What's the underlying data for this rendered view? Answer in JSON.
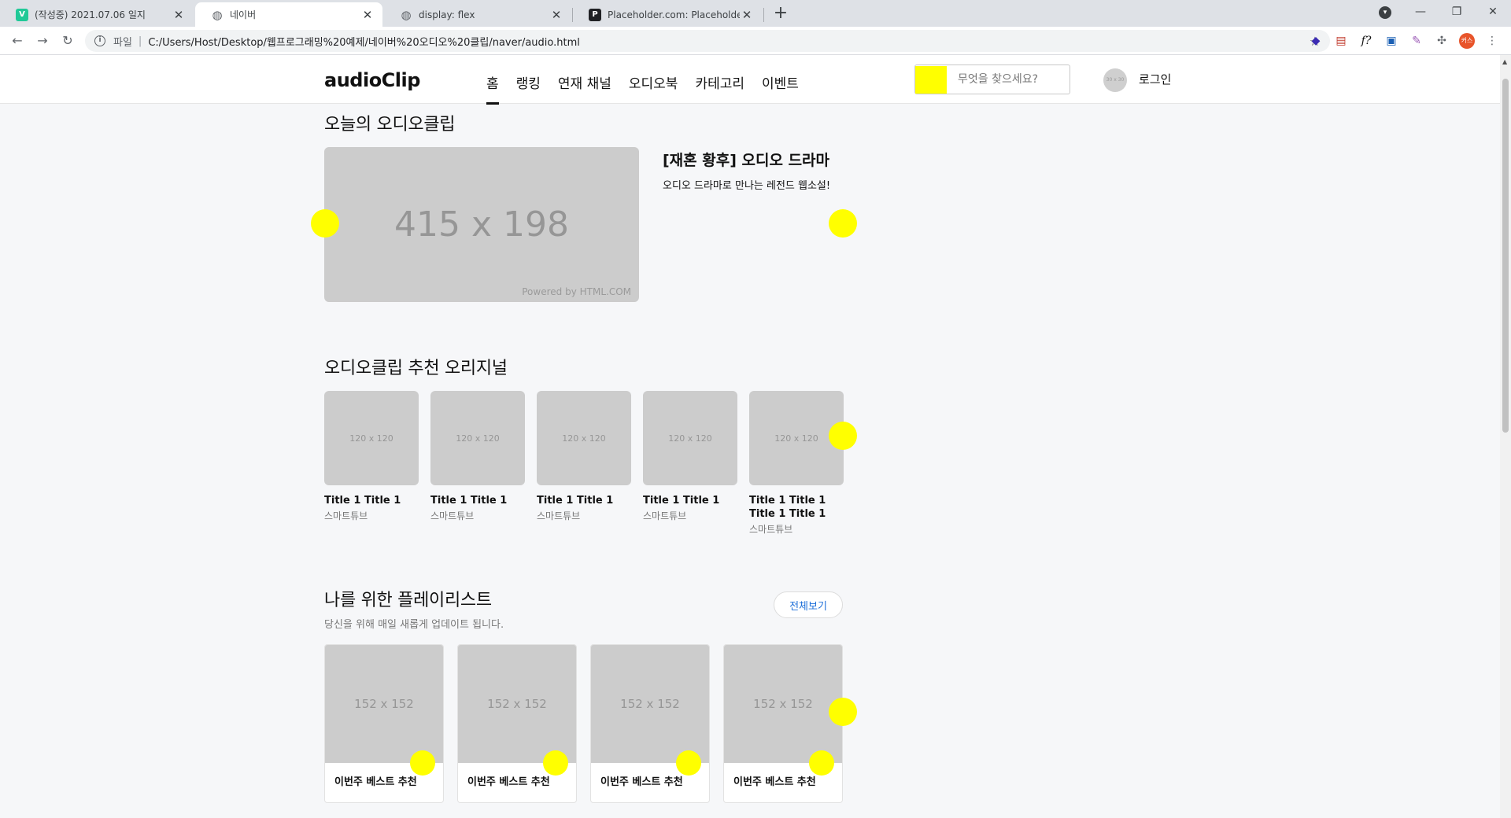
{
  "browser": {
    "tabs": [
      {
        "title": "(작성중) 2021.07.06 일지",
        "favicon": "v-icon"
      },
      {
        "title": "네이버",
        "favicon": "globe-icon",
        "active": true
      },
      {
        "title": "display: flex",
        "favicon": "globe-icon"
      },
      {
        "title": "Placeholder.com: Placeholder.co",
        "favicon": "p-icon"
      }
    ],
    "address": {
      "scheme": "파일",
      "url": "C:/Users/Host/Desktop/웹프로그래밍%20예제/네이버%20오디오%20클립/naver/audio.html"
    },
    "profile_badge": "커스"
  },
  "header": {
    "logo": "audioClip",
    "nav": [
      "홈",
      "랭킹",
      "연재 채널",
      "오디오북",
      "카테고리",
      "이벤트"
    ],
    "search_placeholder": "무엇을 찾으세요?",
    "avatar_label": "30 x 30",
    "login": "로그인"
  },
  "today": {
    "title": "오늘의 오디오클립",
    "image_label": "415 x 198",
    "image_powered": "Powered by HTML.COM",
    "item_title": "[재혼 황후] 오디오 드라마",
    "item_desc": "오디오 드라마로 만나는 레전드 웹소설!"
  },
  "originals": {
    "title": "오디오클립 추천 오리지널",
    "image_label": "120 x 120",
    "items": [
      {
        "title": "Title 1 Title 1",
        "sub": "스마트튜브"
      },
      {
        "title": "Title 1 Title 1",
        "sub": "스마트튜브"
      },
      {
        "title": "Title 1 Title 1",
        "sub": "스마트튜브"
      },
      {
        "title": "Title 1 Title 1",
        "sub": "스마트튜브"
      },
      {
        "title": "Title 1 Title 1 Title 1 Title 1",
        "sub": "스마트튜브"
      }
    ]
  },
  "playlist": {
    "title": "나를 위한 플레이리스트",
    "subtitle": "당신을 위해 매일 새롭게 업데이트 됩니다.",
    "view_all": "전체보기",
    "image_label": "152 x 152",
    "items": [
      {
        "title": "이번주 베스트 추천"
      },
      {
        "title": "이번주 베스트 추천"
      },
      {
        "title": "이번주 베스트 추천"
      },
      {
        "title": "이번주 베스트 추천"
      }
    ]
  },
  "colors": {
    "highlight": "#ffff00",
    "placeholder": "#cccccc",
    "link": "#1e6fd9"
  }
}
